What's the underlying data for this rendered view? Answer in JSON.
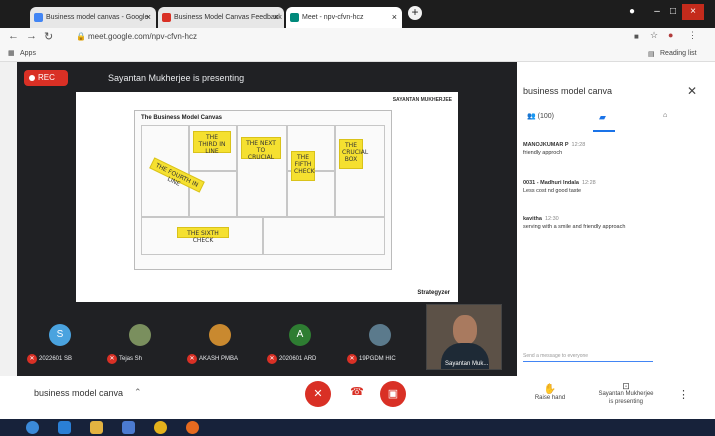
{
  "browser": {
    "tabs": [
      {
        "title": "Business model canvas - Google",
        "fav_color": "#4285f4"
      },
      {
        "title": "Business Model Canvas Feedback",
        "fav_color": "#d93025"
      },
      {
        "title": "Meet - npv-cfvn-hcz",
        "fav_color": "#00897b"
      }
    ],
    "new_tab_label": "+",
    "url": "meet.google.com/npv-cfvn-hcz",
    "apps_label": "Apps",
    "reading_list_label": "Reading list"
  },
  "meet": {
    "rec_label": "REC",
    "presenting_text": "Sayantan Mukherjee is presenting",
    "slide": {
      "author": "SAYANTAN MUKHERJEE",
      "canvas_title": "The Business Model Canvas",
      "brand": "Strategyzer",
      "notes": [
        "THE THIRD IN LINE",
        "THE NEXT TO CRUCIAL",
        "THE FIFTH CHECK",
        "THE CRUCIAL BOX",
        "THE FOURTH IN LINE",
        "THE SIXTH CHECK"
      ]
    },
    "participants": [
      {
        "name": "2022601 SB",
        "initial": "S",
        "color": "#4aa3df"
      },
      {
        "name": "Tejas Sh",
        "initial": "",
        "color": "#7a8f5e"
      },
      {
        "name": "AKASH PMBA",
        "initial": "",
        "color": "#c9892f"
      },
      {
        "name": "2020601 ARD",
        "initial": "A",
        "color": "#2e7d32"
      },
      {
        "name": "19PGDM HIC",
        "initial": "",
        "color": "#5b7a8c"
      }
    ],
    "self_view_name": "Sayantan Muk..."
  },
  "panel": {
    "title": "business model canva",
    "people_count": "(100)",
    "messages": [
      {
        "sender": "MANOJKUMAR P",
        "time": "12:28",
        "text": "friendly approch"
      },
      {
        "sender": "0031 - Madhuri Indala",
        "time": "12:28",
        "text": "Less cost nd good taste"
      },
      {
        "sender": "kavitha",
        "time": "12:30",
        "text": "serving with a smile and friendly approach"
      }
    ],
    "compose_placeholder": "Send a message to everyone"
  },
  "bottom": {
    "meeting_name": "business model canva",
    "raise_hand_label": "Raise hand",
    "presenter_line1": "Sayantan Mukherjee",
    "presenter_line2": "is presenting"
  },
  "colors": {
    "rec": "#d93025",
    "accent": "#1a73e8"
  }
}
